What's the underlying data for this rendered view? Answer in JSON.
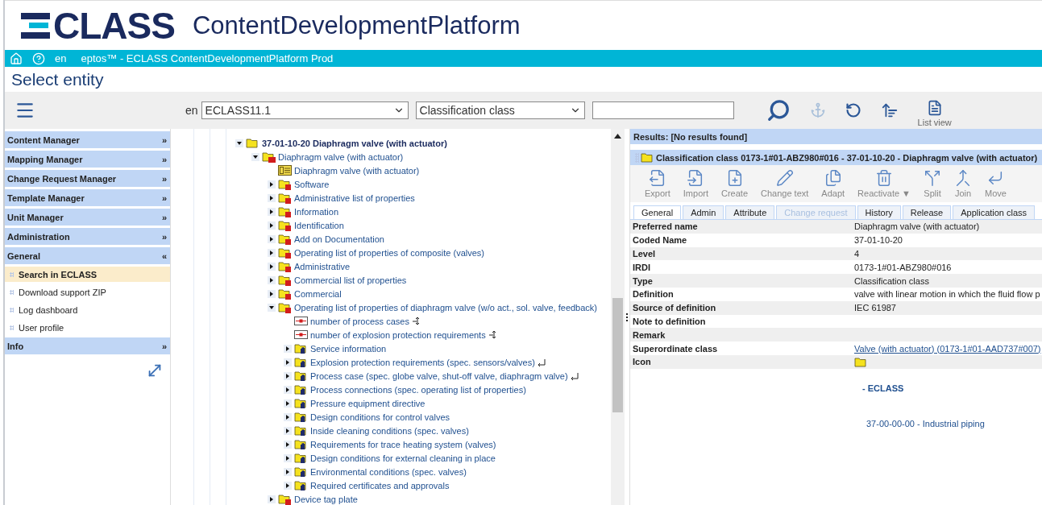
{
  "header": {
    "logo_text": "CLASS",
    "product": "ContentDevelopmentPlatform"
  },
  "topbar": {
    "language": "en",
    "title": "eptos™ - ECLASS ContentDevelopmentPlatform Prod"
  },
  "page_title": "Select entity",
  "toolbar": {
    "language": "en",
    "catalog": "ECLASS11.1",
    "entity_type": "Classification class",
    "tools": [
      {
        "kind": "search",
        "disabled": false
      },
      {
        "kind": "anchor",
        "disabled": true
      },
      {
        "kind": "refresh",
        "disabled": false
      },
      {
        "kind": "sort",
        "disabled": false
      },
      {
        "kind": "list",
        "disabled": false,
        "label": "List view"
      }
    ]
  },
  "sidebar": {
    "sections": [
      {
        "label": "Content Manager",
        "toggle": "»"
      },
      {
        "label": "Mapping Manager",
        "toggle": "»"
      },
      {
        "label": "Change Request Manager",
        "toggle": "»"
      },
      {
        "label": "Template Manager",
        "toggle": "»"
      },
      {
        "label": "Unit Manager",
        "toggle": "»"
      },
      {
        "label": "Administration",
        "toggle": "»"
      },
      {
        "label": "General",
        "toggle": "«",
        "items": [
          {
            "label": "Search in ECLASS",
            "selected": true
          },
          {
            "label": "Download support ZIP",
            "selected": false
          },
          {
            "label": "Log dashboard",
            "selected": false
          },
          {
            "label": "User profile",
            "selected": false
          }
        ]
      },
      {
        "label": "Info",
        "toggle": "»"
      }
    ]
  },
  "tree": {
    "nodes": [
      {
        "label": "37-01-10-20 Diaphragm valve (with actuator)",
        "kind": "folder",
        "expanded": true,
        "children": [
          {
            "label": "Diaphragm valve (with actuator)",
            "kind": "rc_folder",
            "expanded": true,
            "children": [
              {
                "label": "Diaphragm valve (with actuator)",
                "kind": "class"
              },
              {
                "label": "Software",
                "kind": "a_folder",
                "expanded": false
              },
              {
                "label": "Administrative list of properties",
                "kind": "a_folder",
                "expanded": false
              },
              {
                "label": "Information",
                "kind": "a_folder",
                "expanded": false
              },
              {
                "label": "Identification",
                "kind": "a_folder",
                "expanded": false
              },
              {
                "label": "Add on Documentation",
                "kind": "a_folder",
                "expanded": false
              },
              {
                "label": "Operating list of properties of composite (valves)",
                "kind": "a_folder",
                "expanded": false
              },
              {
                "label": "Administrative",
                "kind": "a_folder",
                "expanded": false
              },
              {
                "label": "Commercial list of properties",
                "kind": "a_folder",
                "expanded": false
              },
              {
                "label": "Commercial",
                "kind": "a_folder",
                "expanded": false
              },
              {
                "label": "Operating list of properties of diaphragm valve (w/o act., sol. valve, feedback)",
                "kind": "a_folder",
                "expanded": true,
                "children": [
                  {
                    "label": "number of process cases",
                    "kind": "property"
                  },
                  {
                    "label": "number of explosion protection requirements",
                    "kind": "property"
                  },
                  {
                    "label": "Service information",
                    "kind": "hand_folder",
                    "expanded": false
                  },
                  {
                    "label": "Explosion protection requirements (spec. sensors/valves)",
                    "kind": "linked_hand_folder",
                    "expanded": false
                  },
                  {
                    "label": "Process case (spec. globe valve, shut-off valve, diaphragm valve)",
                    "kind": "linked_hand_folder",
                    "expanded": false
                  },
                  {
                    "label": "Process connections (spec. operating list of properties)",
                    "kind": "hand_folder",
                    "expanded": false
                  },
                  {
                    "label": "Pressure equipment directive",
                    "kind": "hand_folder",
                    "expanded": false
                  },
                  {
                    "label": "Design conditions for control valves",
                    "kind": "hand_folder",
                    "expanded": false
                  },
                  {
                    "label": "Inside cleaning conditions (spec. valves)",
                    "kind": "hand_folder",
                    "expanded": false
                  },
                  {
                    "label": "Requirements for trace heating system (valves)",
                    "kind": "hand_folder",
                    "expanded": false
                  },
                  {
                    "label": "Design conditions for external cleaning in place",
                    "kind": "hand_folder",
                    "expanded": false
                  },
                  {
                    "label": "Environmental conditions (spec. valves)",
                    "kind": "hand_folder",
                    "expanded": false
                  },
                  {
                    "label": "Required certificates and approvals",
                    "kind": "hand_folder",
                    "expanded": false
                  }
                ]
              },
              {
                "label": "Device tag plate",
                "kind": "a_folder",
                "expanded": false
              }
            ]
          }
        ]
      }
    ]
  },
  "results": {
    "header": "Results: [No results found]",
    "entity_title": "Classification class 0173-1#01-ABZ980#016 - 37-01-10-20 - Diaphragm valve (with actuator)",
    "actions": [
      {
        "label": "Export",
        "kind": "export"
      },
      {
        "label": "Import",
        "kind": "import"
      },
      {
        "label": "Create",
        "kind": "create"
      },
      {
        "label": "Change text",
        "kind": "pencil"
      },
      {
        "label": "Adapt",
        "kind": "adapt"
      },
      {
        "label": "Reactivate ▼",
        "kind": "reactivate"
      },
      {
        "label": "Split",
        "kind": "split"
      },
      {
        "label": "Join",
        "kind": "join"
      },
      {
        "label": "Move",
        "kind": "move"
      }
    ],
    "tabs": [
      {
        "label": "General",
        "selected": true,
        "disabled": false
      },
      {
        "label": "Admin",
        "selected": false,
        "disabled": false
      },
      {
        "label": "Attribute",
        "selected": false,
        "disabled": false
      },
      {
        "label": "Change request",
        "selected": false,
        "disabled": true
      },
      {
        "label": "History",
        "selected": false,
        "disabled": false
      },
      {
        "label": "Release",
        "selected": false,
        "disabled": false
      },
      {
        "label": "Application class",
        "selected": false,
        "disabled": false
      }
    ],
    "properties": [
      {
        "name": "Preferred name",
        "kind": "text",
        "value": "Diaphragm valve (with actuator)"
      },
      {
        "name": "Coded Name",
        "kind": "text",
        "value": "37-01-10-20"
      },
      {
        "name": "Level",
        "kind": "text",
        "value": "4"
      },
      {
        "name": "IRDI",
        "kind": "text",
        "value": "0173-1#01-ABZ980#016"
      },
      {
        "name": "Type",
        "kind": "text",
        "value": "Classification class"
      },
      {
        "name": "Definition",
        "kind": "text",
        "value": "valve with linear motion in which the fluid flow p"
      },
      {
        "name": "Source of definition",
        "kind": "text",
        "value": "IEC 61987"
      },
      {
        "name": "Note to definition",
        "kind": "empty"
      },
      {
        "name": "Remark",
        "kind": "empty"
      },
      {
        "name": "Superordinate class",
        "kind": "link",
        "value": "Valve (with actuator) (0173-1#01-AAD737#007)"
      },
      {
        "name": "Icon",
        "kind": "icon"
      }
    ],
    "breadcrumb": [
      "- ECLASS",
      "37-00-00-00 - Industrial piping"
    ]
  }
}
